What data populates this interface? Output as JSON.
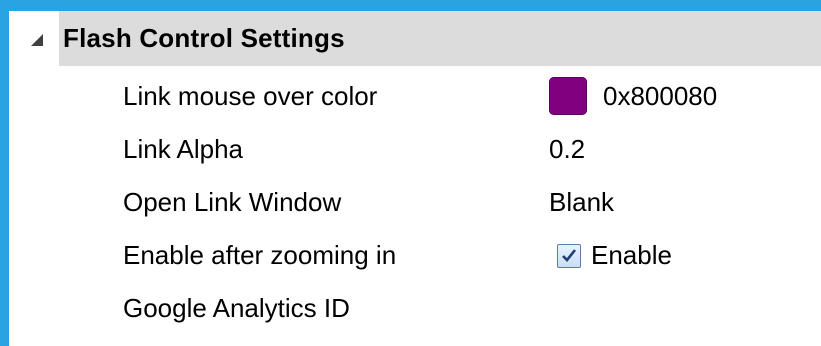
{
  "section": {
    "title": "Flash Control Settings",
    "expanded": true
  },
  "properties": [
    {
      "label": "Link mouse over color",
      "value": "0x800080",
      "swatch_color": "#800080"
    },
    {
      "label": "Link Alpha",
      "value": "0.2"
    },
    {
      "label": "Open Link Window",
      "value": "Blank"
    },
    {
      "label": "Enable after zooming in",
      "value": "Enable",
      "checked": true
    },
    {
      "label": "Google Analytics ID",
      "value": ""
    }
  ],
  "colors": {
    "frame_border": "#2aa3e3",
    "header_background": "#dcdcdc",
    "swatch": "#800080"
  }
}
